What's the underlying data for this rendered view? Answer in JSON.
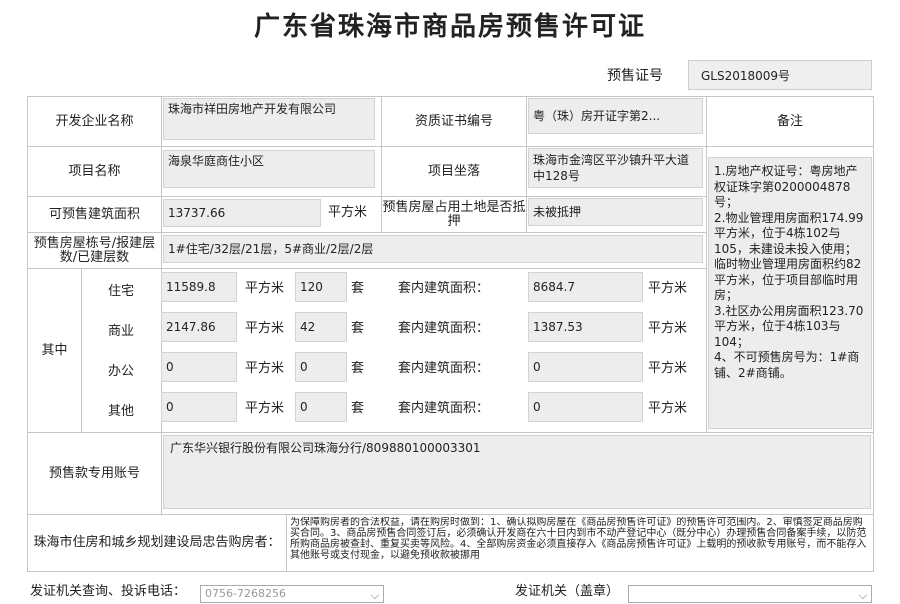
{
  "title": "广东省珠海市商品房预售许可证",
  "permit": {
    "label": "预售证号",
    "value": "GLS2018009号"
  },
  "developer": {
    "label": "开发企业名称",
    "value": "珠海市祥田房地产开发有限公司"
  },
  "qualification": {
    "label": "资质证书编号",
    "value": "粤（珠）房开证字第2..."
  },
  "remarks_label": "备注",
  "remarks_text": "1.房地产权证号：粤房地产权证珠字第0200004878号；\n    2.物业管理用房面积174.99平方米，位于4栋102与105，未建设未投入使用；临时物业管理用房面积约82平方米，位于项目部临时用房；\n    3.社区办公用房面积123.70平方米，位于4栋103与104；\n    4、不可预售房号为：1#商铺、2#商铺。",
  "project": {
    "label": "项目名称",
    "value": "海泉华庭商住小区"
  },
  "location": {
    "label": "项目坐落",
    "value": "珠海市金湾区平沙镇升平大道中128号"
  },
  "area": {
    "label": "可预售建筑面积",
    "value": "13737.66",
    "unit": "平方米"
  },
  "mortgage": {
    "label": "预售房屋占用土地是否抵押",
    "value": "未被抵押"
  },
  "buildings": {
    "label": "预售房屋栋号/报建层数/已建层数",
    "value": "1#住宅/32层/21层，5#商业/2层/2层"
  },
  "breakdown_label": "其中",
  "unit_sqm": "平方米",
  "unit_set": "套",
  "inner_label": "套内建筑面积：",
  "rows": [
    {
      "type": "住宅",
      "area": "11589.8",
      "count": "120",
      "inner": "8684.7"
    },
    {
      "type": "商业",
      "area": "2147.86",
      "count": "42",
      "inner": "1387.53"
    },
    {
      "type": "办公",
      "area": "0",
      "count": "0",
      "inner": "0"
    },
    {
      "type": "其他",
      "area": "0",
      "count": "0",
      "inner": "0"
    }
  ],
  "account": {
    "label": "预售款专用账号",
    "value": "广东华兴银行股份有限公司珠海分行/809880100003301"
  },
  "notice": {
    "label": "珠海市住房和城乡规划建设局忠告购房者：",
    "text": "为保障购房者的合法权益，请在购房时做到：1、确认拟购房屋在《商品房预售许可证》的预售许可范围内。2、审慎签定商品房购买合同。3、商品房预售合同签订后，必须确认开发商在六十日内到市不动产登记中心（既分中心）办理预售合同备案手续，以防范所购商品房被查封、重复买卖等风险。4、全部购房资金必须直接存入《商品房预售许可证》上载明的预收款专用账号，而不能存入其他账号或支付现金，以避免预收款被挪用"
  },
  "footer": {
    "left_label": "发证机关查询、投诉电话：",
    "phone": "0756-7268256",
    "right_label": "发证机关（盖章）"
  }
}
